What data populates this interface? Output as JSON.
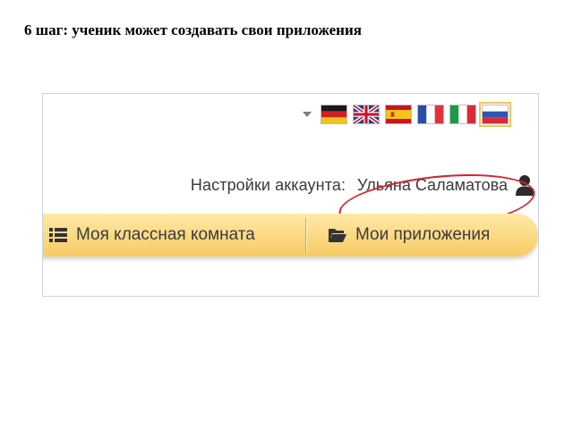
{
  "slide": {
    "title": "6 шаг: ученик может создавать свои приложения"
  },
  "language_bar": {
    "flags": [
      {
        "icon": "flag-germany-icon"
      },
      {
        "icon": "flag-uk-icon"
      },
      {
        "icon": "flag-spain-icon"
      },
      {
        "icon": "flag-france-icon"
      },
      {
        "icon": "flag-italy-icon"
      },
      {
        "icon": "flag-russia-icon",
        "selected": true
      }
    ]
  },
  "account": {
    "label": "Настройки аккаунта:",
    "user_name": "Ульяна Саламатова",
    "icon": "user-icon"
  },
  "nav": {
    "classroom_label": "Моя классная комната",
    "classroom_icon": "list-icon",
    "apps_label": "Мои приложения",
    "apps_icon": "folder-open-icon"
  },
  "colors": {
    "highlight": "#d6232e",
    "nav_top": "#ffe9a7",
    "nav_bottom": "#f7cb64"
  }
}
